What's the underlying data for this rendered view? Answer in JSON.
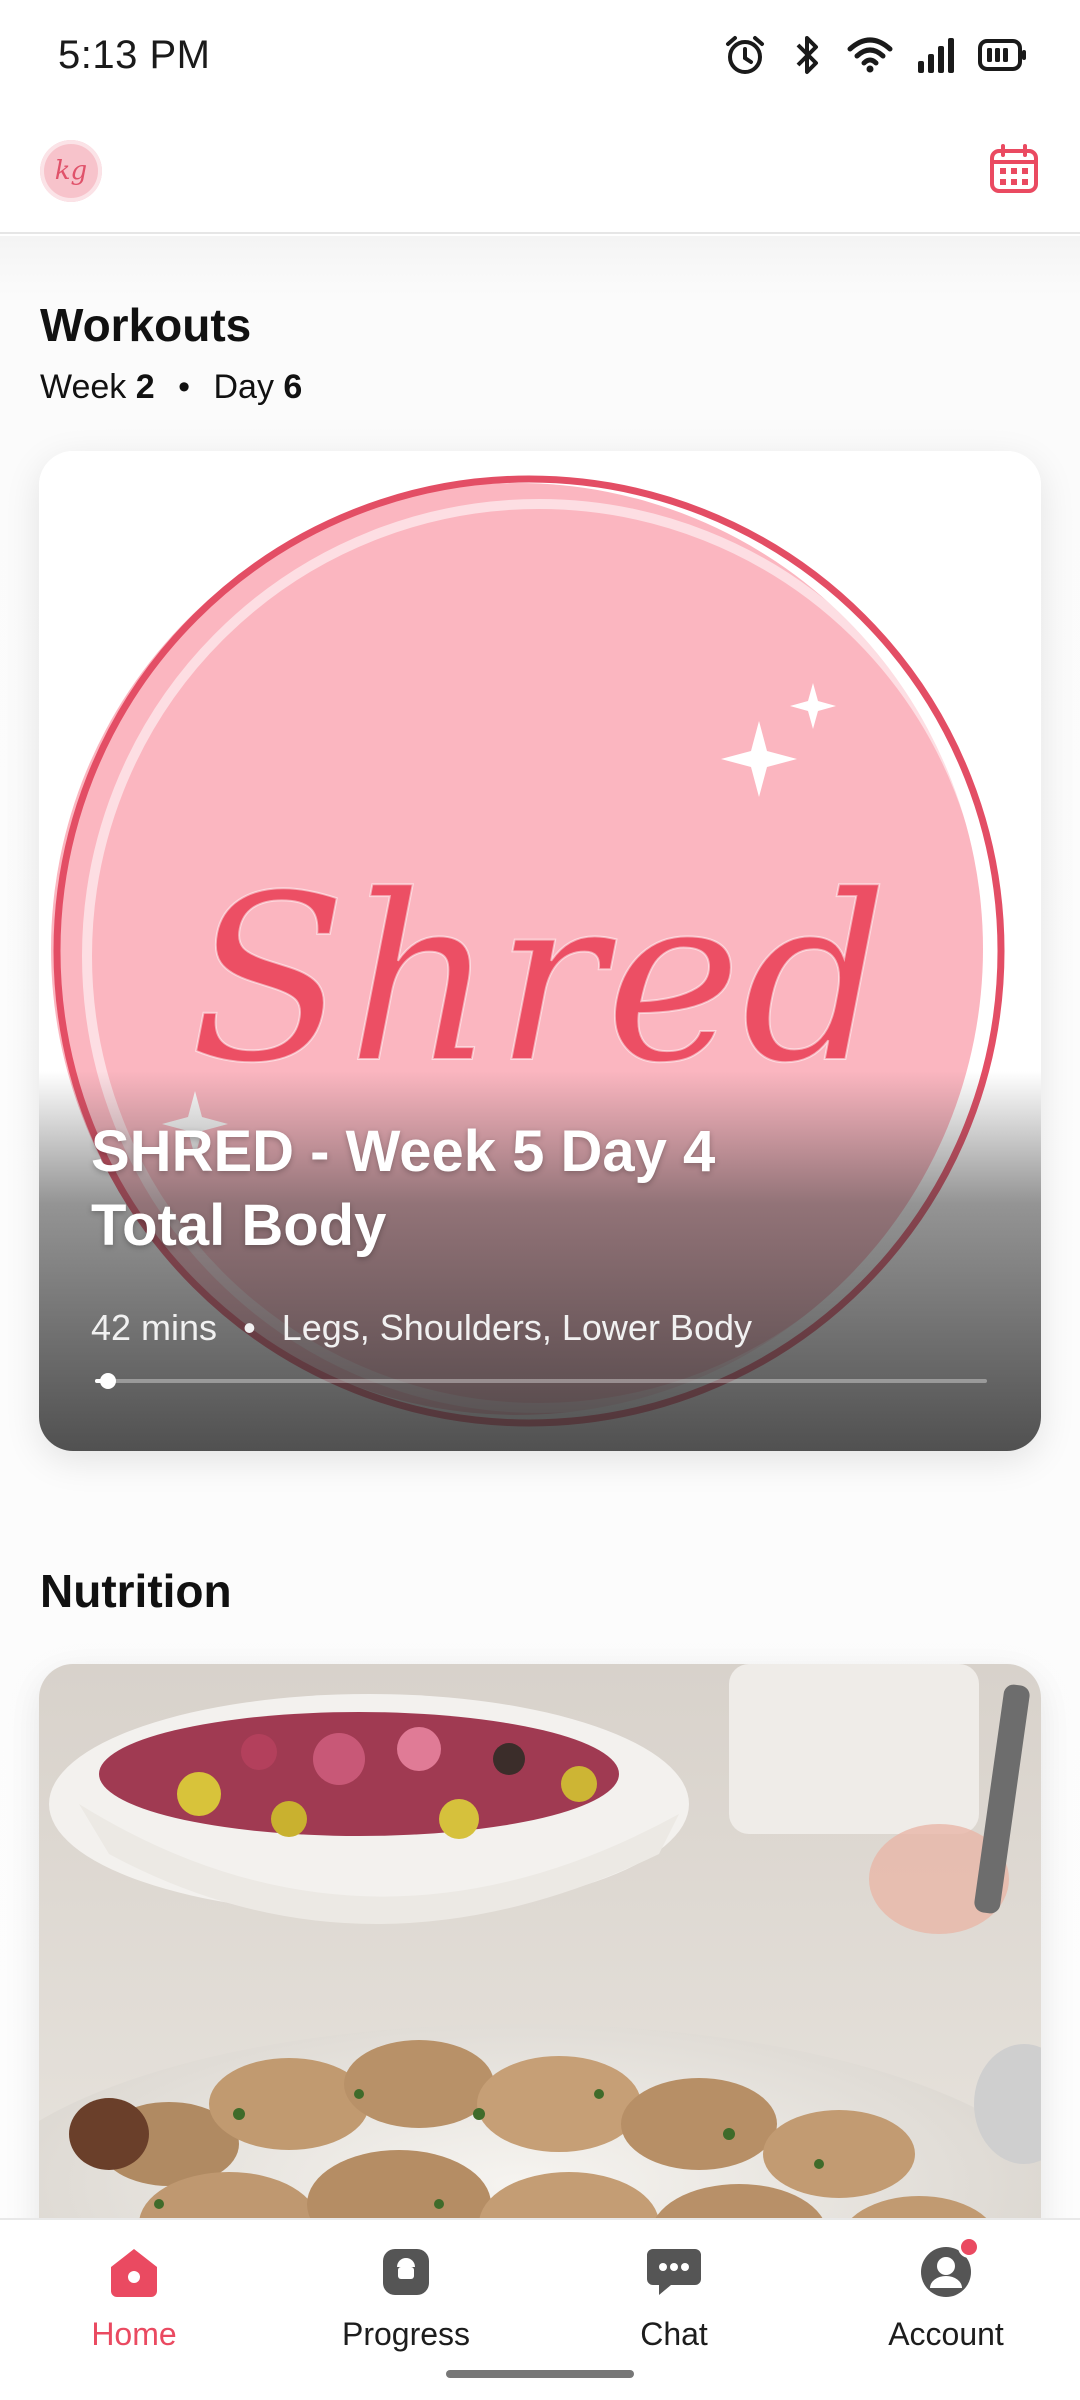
{
  "status_bar": {
    "time": "5:13 PM",
    "icons": [
      "alarm-icon",
      "bluetooth-icon",
      "wifi-icon",
      "signal-icon",
      "battery-icon"
    ]
  },
  "header": {
    "logo_text": "kg",
    "calendar_icon": "calendar-icon"
  },
  "workouts": {
    "title": "Workouts",
    "week_label": "Week",
    "week_value": "2",
    "day_label": "Day",
    "day_value": "6",
    "separator": "•",
    "card": {
      "art_script": "Shred",
      "title": "SHRED  - Week 5 Day 4\nTotal Body",
      "duration": "42 mins",
      "separator": "•",
      "tags": "Legs, Shoulders, Lower Body",
      "progress": 0.01
    }
  },
  "nutrition": {
    "title": "Nutrition"
  },
  "bottom_nav": {
    "items": [
      {
        "label": "Home",
        "icon": "home-icon",
        "active": true
      },
      {
        "label": "Progress",
        "icon": "scale-icon",
        "active": false
      },
      {
        "label": "Chat",
        "icon": "chat-icon",
        "active": false
      },
      {
        "label": "Account",
        "icon": "account-icon",
        "active": false,
        "badge": true
      }
    ]
  },
  "colors": {
    "accent": "#ea4a61",
    "card_pink": "#fbb6c0",
    "ring": "#e34e65"
  }
}
